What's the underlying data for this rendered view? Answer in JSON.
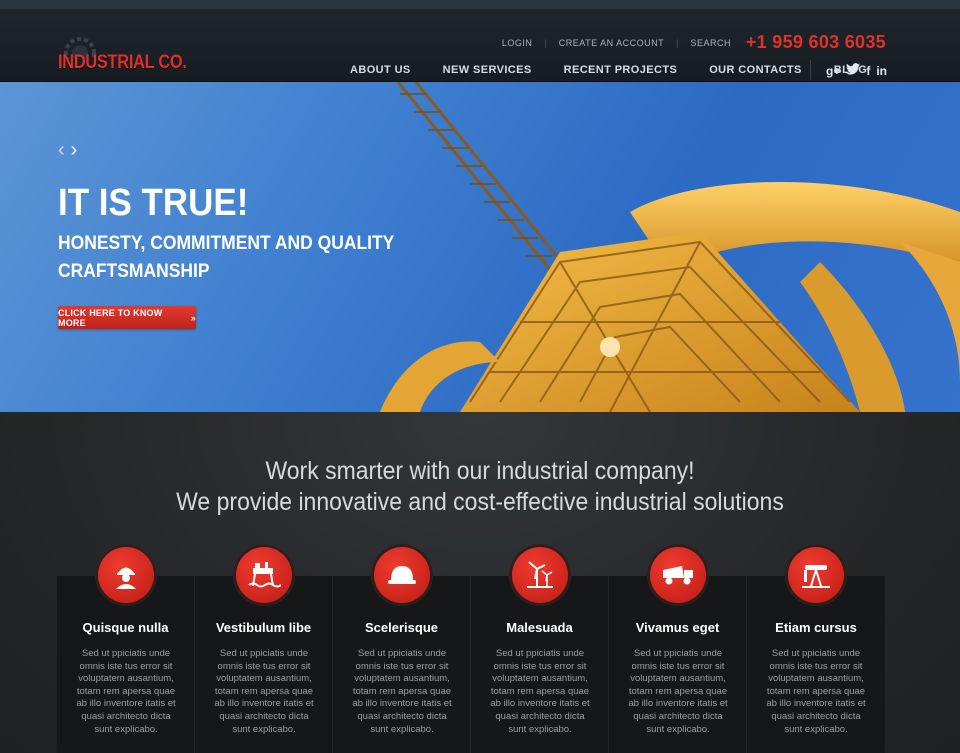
{
  "brand": {
    "name": "INDUSTRIAL CO.",
    "accent": "#e0302a"
  },
  "toplinks": [
    "LOGIN",
    "CREATE AN ACCOUNT",
    "SEARCH"
  ],
  "phone": "+1 959 603 6035",
  "nav": [
    "ABOUT US",
    "NEW SERVICES",
    "RECENT PROJECTS",
    "OUR CONTACTS",
    "BLOG"
  ],
  "social": [
    "g+",
    "twitter-icon",
    "facebook-icon",
    "linkedin-icon"
  ],
  "hero": {
    "title": "IT IS TRUE!",
    "subtitle": "HONESTY, COMMITMENT AND QUALITY CRAFTSMANSHIP",
    "cta": "CLICK HERE TO KNOW MORE"
  },
  "section": {
    "line1": "Work smarter with our industrial company!",
    "line2": "We provide innovative and cost-effective industrial solutions"
  },
  "features": [
    {
      "title": "Quisque nulla",
      "icon": "worker-icon",
      "text": "Sed ut ppiciatis unde omnis iste tus error sit voluptatem ausantium, totam rem apersa quae ab illo inventore itatis et quasi architecto dicta sunt explicabo."
    },
    {
      "title": "Vestibulum libe",
      "icon": "oil-platform-icon",
      "text": "Sed ut ppiciatis unde omnis iste tus error sit voluptatem ausantium, totam rem apersa quae ab illo inventore itatis et quasi architecto dicta sunt explicabo."
    },
    {
      "title": "Scelerisque",
      "icon": "hard-hat-icon",
      "text": "Sed ut ppiciatis unde omnis iste tus error sit voluptatem ausantium, totam rem apersa quae ab illo inventore itatis et quasi architecto dicta sunt explicabo."
    },
    {
      "title": "Malesuada",
      "icon": "wind-turbine-icon",
      "text": "Sed ut ppiciatis unde omnis iste tus error sit voluptatem ausantium, totam rem apersa quae ab illo inventore itatis et quasi architecto dicta sunt explicabo."
    },
    {
      "title": "Vivamus eget",
      "icon": "dump-truck-icon",
      "text": "Sed ut ppiciatis unde omnis iste tus error sit voluptatem ausantium, totam rem apersa quae ab illo inventore itatis et quasi architecto dicta sunt explicabo."
    },
    {
      "title": "Etiam cursus",
      "icon": "oil-pump-icon",
      "text": "Sed ut ppiciatis unde omnis iste tus error sit voluptatem ausantium, totam rem apersa quae ab illo inventore itatis et quasi architecto dicta sunt explicabo."
    }
  ]
}
